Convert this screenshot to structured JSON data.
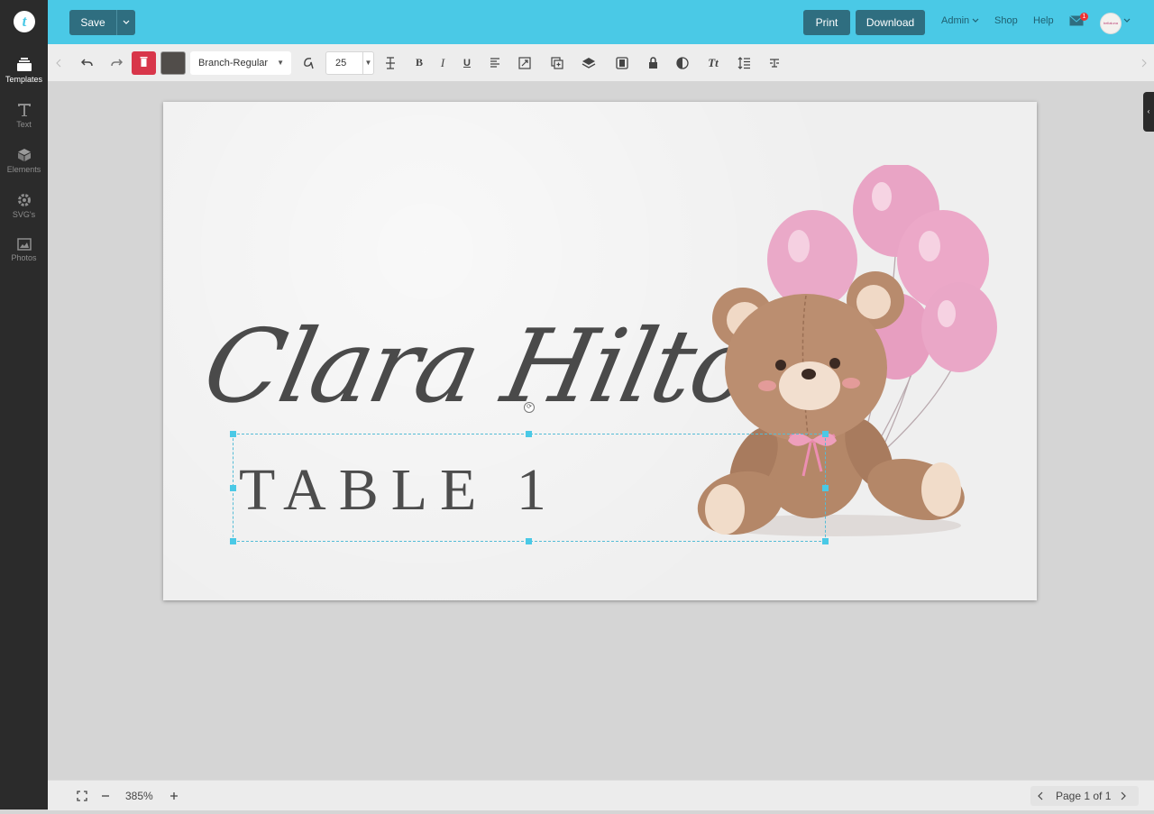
{
  "app": {
    "logo_letter": "t"
  },
  "sidebar": {
    "items": [
      {
        "label": "Templates",
        "icon": "templates-icon",
        "active": true
      },
      {
        "label": "Text",
        "icon": "text-icon"
      },
      {
        "label": "Elements",
        "icon": "cube-icon"
      },
      {
        "label": "SVG's",
        "icon": "gear-icon"
      },
      {
        "label": "Photos",
        "icon": "photo-icon"
      }
    ]
  },
  "header": {
    "save_label": "Save",
    "print_label": "Print",
    "download_label": "Download",
    "admin_label": "Admin",
    "shop_label": "Shop",
    "help_label": "Help",
    "mail_badge": "1",
    "avatar_text": "bellaluna",
    "accent_color": "#4ac9e6"
  },
  "toolbar": {
    "font_name": "Branch-Regular",
    "font_size": "25",
    "text_color": "#514d4a",
    "bold_label": "B",
    "italic_label": "I",
    "underline_label": "U",
    "text_style_label": "Tt"
  },
  "canvas": {
    "guest_name": "Clara Hilton",
    "table_label": "TABLE 1"
  },
  "footer": {
    "zoom": "385%",
    "page_label": "Page 1 of 1"
  }
}
